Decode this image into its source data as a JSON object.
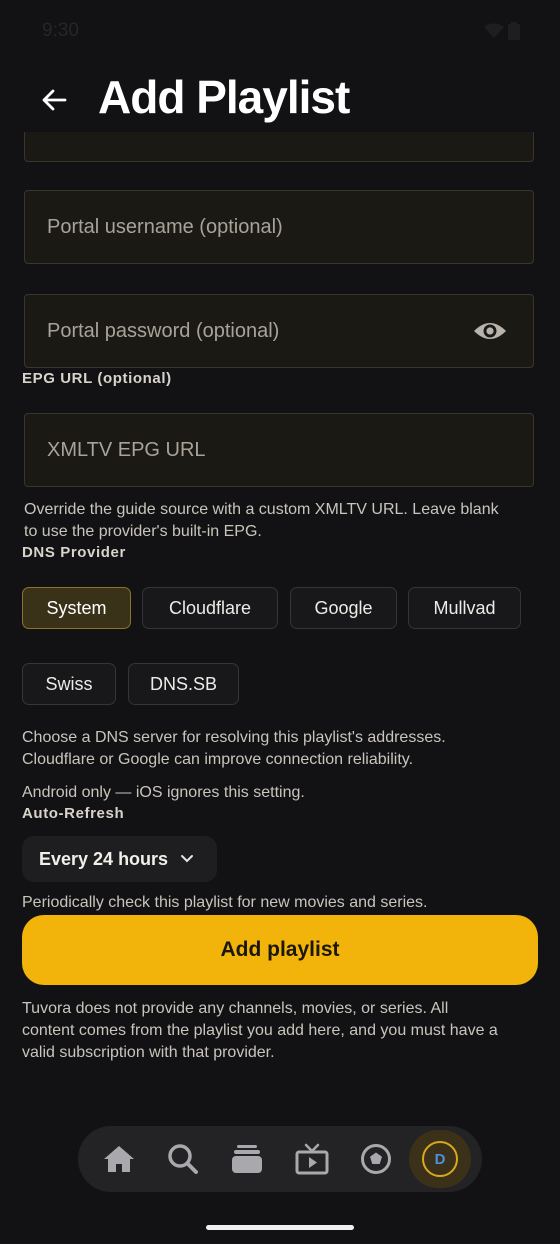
{
  "status_bar": {
    "time": "9:30",
    "icons": [
      "wifi-icon",
      "battery-icon"
    ]
  },
  "header": {
    "title": "Add Playlist",
    "back_icon": "arrow-left-icon"
  },
  "form": {
    "username": {
      "placeholder": "Portal username (optional)",
      "value": ""
    },
    "password": {
      "placeholder": "Portal password (optional)",
      "value": "",
      "icon": "eye-icon"
    },
    "epg": {
      "label": "EPG URL (optional)",
      "placeholder": "XMLTV EPG URL",
      "value": "",
      "help_line1": "Override the guide source with a custom XMLTV URL. Leave blank",
      "help_line2": "to use the provider's built-in EPG."
    },
    "dns": {
      "label": "DNS Provider",
      "options": [
        "System",
        "Cloudflare",
        "Google",
        "Mullvad",
        "Swiss",
        "DNS.SB"
      ],
      "selected": "System",
      "help_line1": "Choose a DNS server for resolving this playlist's addresses.",
      "help_line2": "Cloudflare or Google can improve connection reliability.",
      "note": "Android only — iOS ignores this setting."
    },
    "refresh": {
      "label": "Auto-Refresh",
      "selected": "Every 24 hours",
      "help": "Periodically check this playlist for new movies and series."
    }
  },
  "primary_button": {
    "label": "Add playlist"
  },
  "disclaimer": {
    "line1": "Tuvora does not provide any channels, movies, or series. All",
    "line2": "content comes from the playlist you add here, and you must have a",
    "line3": "valid subscription with that provider."
  },
  "bottom_nav": {
    "items": [
      "home-icon",
      "search-icon",
      "library-icon",
      "tv-icon",
      "discover-icon",
      "profile-avatar"
    ],
    "avatar_initial": "D",
    "active": "profile-avatar"
  },
  "colors": {
    "accent": "#f2b40a",
    "background": "#121214",
    "chip_selected": "#3a3218"
  }
}
